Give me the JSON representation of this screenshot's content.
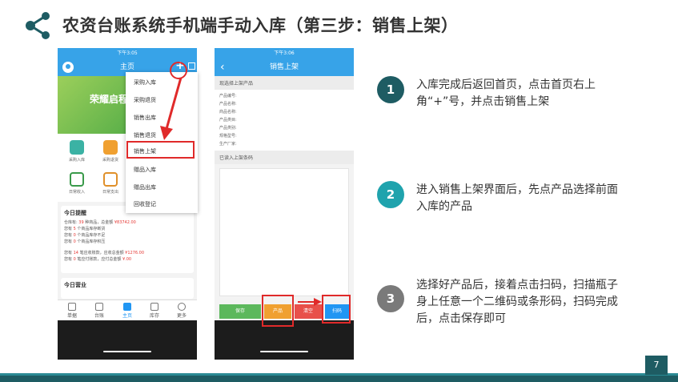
{
  "slide": {
    "title": "农资台账系统手机端手动入库（第三步：销售上架）",
    "page_number": "7"
  },
  "phone_home": {
    "status_time": "下午3:05",
    "app_title": "主页",
    "plus_label": "+",
    "banner_text": "荣耀启程",
    "grid_items": [
      "采购入库",
      "采购退货",
      "日常收入",
      "日常支出"
    ],
    "dropdown": [
      "采购入库",
      "采购退货",
      "销售出库",
      "销售退货",
      "销售上架",
      "赠品入库",
      "赠品出库",
      "回收登记"
    ],
    "reminder": {
      "title": "今日提醒",
      "lines": [
        "仓库有: 39 种商品，总金额 ¥83742.00",
        "您有 5 个商品库存断货",
        "您有 0 个商品库存不足",
        "您有 0 个商品库存积压",
        "您有 14 笔应收账款，应收总金额 ¥1276.00",
        "您有 0 笔应付账款，应付总金额 ¥.00"
      ]
    },
    "business_title": "今日营业",
    "tabs": [
      "单据",
      "台账",
      "主页",
      "库存",
      "更多"
    ]
  },
  "phone_shelf": {
    "status_time": "下午3:06",
    "app_title": "销售上架",
    "back_icon": "‹",
    "selected_products_header": "现选择上架产品",
    "fields": [
      "产品编号:",
      "产品名称:",
      "商品名称:",
      "产品类目:",
      "产品类别:",
      "规格型号:",
      "生产厂家:"
    ],
    "scanned_header": "已读入上架条码",
    "buttons": {
      "save": "保存",
      "product": "产品",
      "clear": "清空",
      "scan": "扫码"
    }
  },
  "steps": [
    {
      "number": "1",
      "text": "入库完成后返回首页，点击首页右上角“+”号，并点击销售上架",
      "color": "#1e5c63"
    },
    {
      "number": "2",
      "text": "进入销售上架界面后，先点产品选择前面入库的产品",
      "color": "#1fa3ad"
    },
    {
      "number": "3",
      "text": "选择好产品后，接着点击扫码，扫描瓶子身上任意一个二维码或条形码，扫码完成后，点击保存即可",
      "color": "#7a7a7a"
    }
  ],
  "colors": {
    "primary_blue": "#37a3e8",
    "annotation_red": "#e02a2a",
    "footer_teal": "#1e5c63"
  }
}
